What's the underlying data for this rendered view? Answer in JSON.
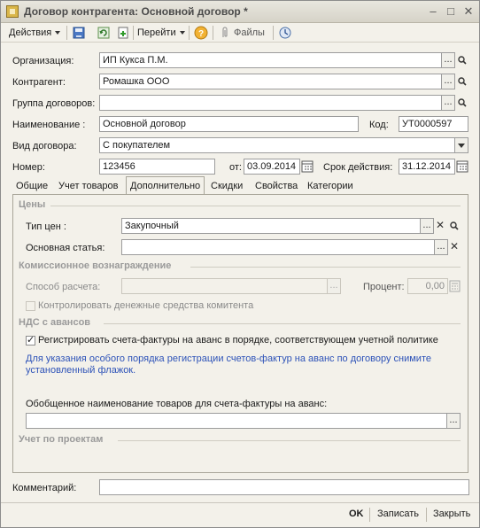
{
  "window": {
    "title": "Договор контрагента: Основной договор *",
    "minimize": "‒",
    "maximize": "□",
    "close": "✕"
  },
  "toolbar": {
    "actions": "Действия",
    "goto": "Перейти",
    "files": "Файлы"
  },
  "form": {
    "organization_label": "Организация:",
    "organization_value": "ИП Кукса П.М.",
    "counterparty_label": "Контрагент:",
    "counterparty_value": "Ромашка ООО",
    "group_label": "Группа договоров:",
    "group_value": "",
    "name_label": "Наименование :",
    "name_value": "Основной договор",
    "code_label": "Код:",
    "code_value": "УТ0000597",
    "type_label": "Вид договора:",
    "type_value": "С покупателем",
    "number_label": "Номер:",
    "number_value": "123456",
    "from_label": "от:",
    "from_value": "03.09.2014",
    "validity_label": "Срок действия:",
    "validity_value": "31.12.2014"
  },
  "tabs": [
    "Общие",
    "Учет товаров",
    "Дополнительно",
    "Скидки",
    "Свойства",
    "Категории"
  ],
  "panel": {
    "prices_group": "Цены",
    "price_type_label": "Тип цен :",
    "price_type_value": "Закупочный",
    "main_item_label": "Основная статья:",
    "main_item_value": "",
    "commission_group": "Комиссионное вознаграждение",
    "calc_method_label": "Способ расчета:",
    "calc_method_value": "",
    "percent_label": "Процент:",
    "percent_value": "0,00",
    "control_funds_label": "Контролировать денежные средства комитента",
    "vat_group": "НДС с авансов",
    "register_invoices_label": "Регистрировать счета-фактуры на аванс в порядке, соответствующем учетной политике",
    "info_text": "Для указания особого порядка регистрации счетов-фактур на аванс по договору снимите установленный флажок.",
    "generalized_label": "Обобщенное наименование товаров для счета-фактуры на аванс:",
    "generalized_value": "",
    "projects_group": "Учет по проектам"
  },
  "comment_label": "Комментарий:",
  "comment_value": "",
  "buttons": {
    "ok": "OK",
    "write": "Записать",
    "close": "Закрыть"
  },
  "icons": {
    "ellipsis": "...",
    "clear": "✕"
  }
}
